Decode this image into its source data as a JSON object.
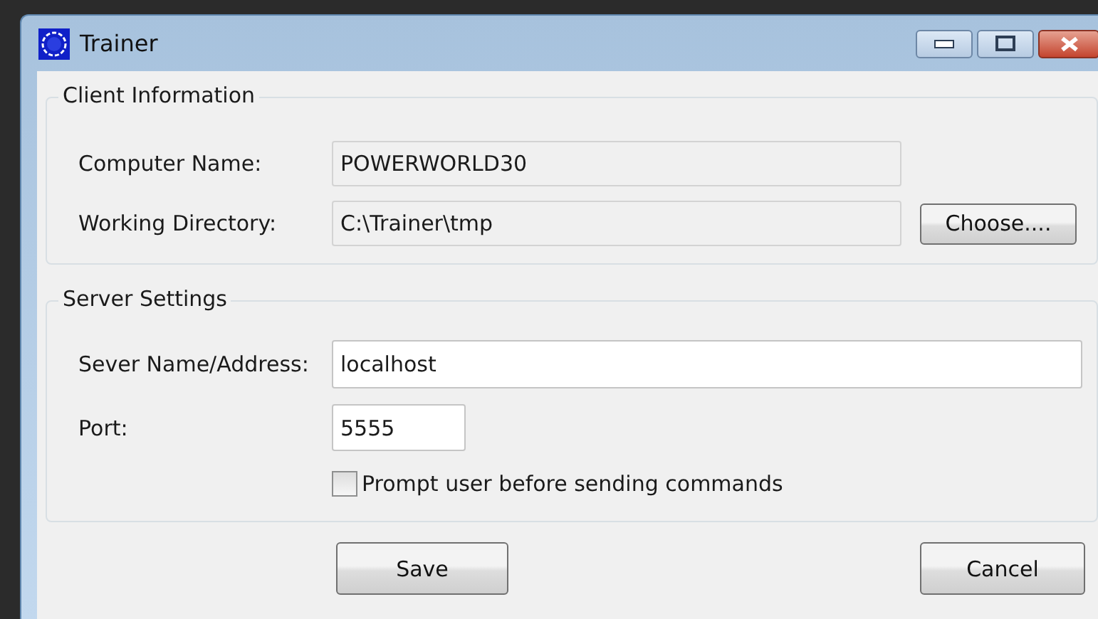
{
  "window": {
    "title": "Trainer"
  },
  "client_information": {
    "title": "Client Information",
    "fields": [
      {
        "label": "Computer Name:",
        "value": "POWERWORLD30",
        "disabled": true
      },
      {
        "label": "Working Directory:",
        "value": "C:\\Trainer\\tmp",
        "disabled": true
      }
    ],
    "choose_button": "Choose...."
  },
  "server_settings": {
    "title": "Server Settings",
    "fields": [
      {
        "label": "Sever Name/Address:",
        "value": "localhost",
        "disabled": false
      },
      {
        "label": "Port:",
        "value": "5555",
        "disabled": false
      }
    ],
    "checkbox": {
      "label": "Prompt user before sending commands",
      "checked": false
    }
  },
  "buttons": [
    "Save",
    "Cancel"
  ]
}
